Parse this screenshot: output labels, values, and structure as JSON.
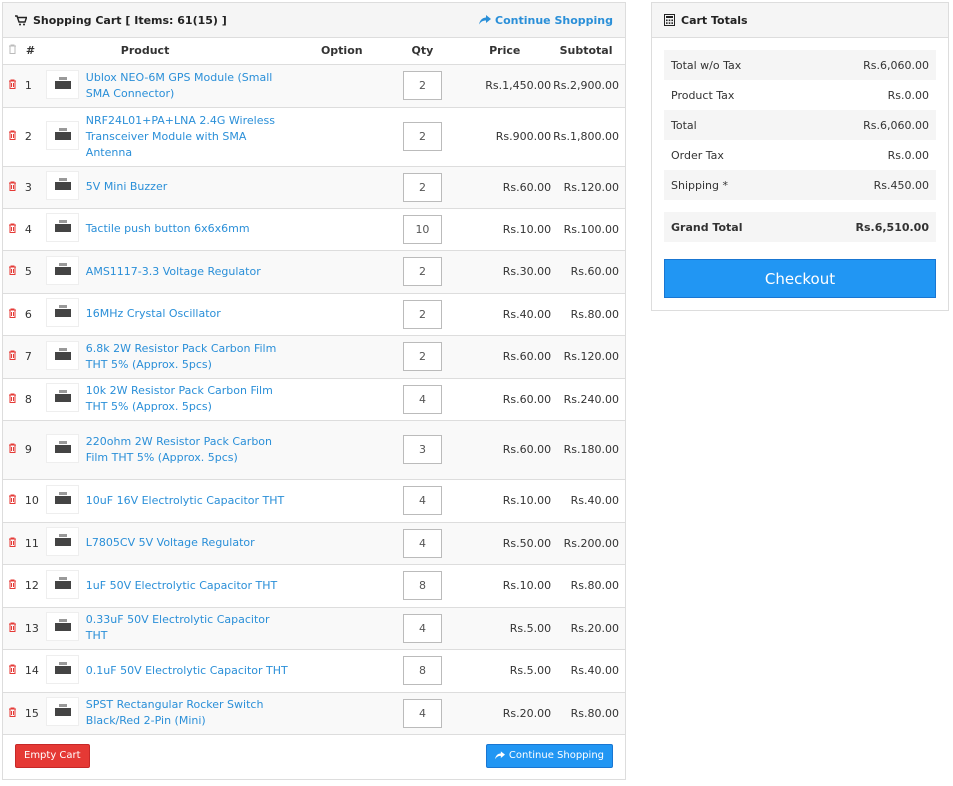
{
  "cart": {
    "title": "Shopping Cart [ Items: 61(15) ]",
    "continue_label": "Continue Shopping",
    "columns": {
      "num": "#",
      "product": "Product",
      "option": "Option",
      "qty": "Qty",
      "price": "Price",
      "subtotal": "Subtotal"
    },
    "items": [
      {
        "num": "1",
        "name": "Ublox NEO-6M GPS Module (Small SMA Connector)",
        "option": "",
        "qty": "2",
        "price": "Rs.1,450.00",
        "subtotal": "Rs.2,900.00"
      },
      {
        "num": "2",
        "name": "NRF24L01+PA+LNA 2.4G Wireless Transceiver Module with SMA Antenna",
        "option": "",
        "qty": "2",
        "price": "Rs.900.00",
        "subtotal": "Rs.1,800.00"
      },
      {
        "num": "3",
        "name": "5V Mini Buzzer",
        "option": "",
        "qty": "2",
        "price": "Rs.60.00",
        "subtotal": "Rs.120.00"
      },
      {
        "num": "4",
        "name": "Tactile push button 6x6x6mm",
        "option": "",
        "qty": "10",
        "price": "Rs.10.00",
        "subtotal": "Rs.100.00"
      },
      {
        "num": "5",
        "name": "AMS1117-3.3 Voltage Regulator",
        "option": "",
        "qty": "2",
        "price": "Rs.30.00",
        "subtotal": "Rs.60.00"
      },
      {
        "num": "6",
        "name": "16MHz Crystal Oscillator",
        "option": "",
        "qty": "2",
        "price": "Rs.40.00",
        "subtotal": "Rs.80.00"
      },
      {
        "num": "7",
        "name": "6.8k 2W Resistor Pack Carbon Film THT 5% (Approx. 5pcs)",
        "option": "",
        "qty": "2",
        "price": "Rs.60.00",
        "subtotal": "Rs.120.00"
      },
      {
        "num": "8",
        "name": "10k 2W Resistor Pack Carbon Film THT 5% (Approx. 5pcs)",
        "option": "",
        "qty": "4",
        "price": "Rs.60.00",
        "subtotal": "Rs.240.00"
      },
      {
        "num": "9",
        "name": "220ohm 2W Resistor Pack Carbon Film THT 5% (Approx. 5pcs)",
        "option": "",
        "qty": "3",
        "price": "Rs.60.00",
        "subtotal": "Rs.180.00"
      },
      {
        "num": "10",
        "name": "10uF 16V Electrolytic Capacitor THT",
        "option": "",
        "qty": "4",
        "price": "Rs.10.00",
        "subtotal": "Rs.40.00"
      },
      {
        "num": "11",
        "name": "L7805CV 5V Voltage Regulator",
        "option": "",
        "qty": "4",
        "price": "Rs.50.00",
        "subtotal": "Rs.200.00"
      },
      {
        "num": "12",
        "name": "1uF 50V Electrolytic Capacitor THT",
        "option": "",
        "qty": "8",
        "price": "Rs.10.00",
        "subtotal": "Rs.80.00"
      },
      {
        "num": "13",
        "name": "0.33uF 50V Electrolytic Capacitor THT",
        "option": "",
        "qty": "4",
        "price": "Rs.5.00",
        "subtotal": "Rs.20.00"
      },
      {
        "num": "14",
        "name": "0.1uF 50V Electrolytic Capacitor THT",
        "option": "",
        "qty": "8",
        "price": "Rs.5.00",
        "subtotal": "Rs.40.00"
      },
      {
        "num": "15",
        "name": "SPST Rectangular Rocker Switch Black/Red 2-Pin (Mini)",
        "option": "",
        "qty": "4",
        "price": "Rs.20.00",
        "subtotal": "Rs.80.00"
      }
    ],
    "empty_cart_label": "Empty Cart",
    "footer_continue_label": "Continue Shopping"
  },
  "totals": {
    "title": "Cart Totals",
    "rows": [
      {
        "label": "Total w/o Tax",
        "value": "Rs.6,060.00"
      },
      {
        "label": "Product Tax",
        "value": "Rs.0.00"
      },
      {
        "label": "Total",
        "value": "Rs.6,060.00"
      },
      {
        "label": "Order Tax",
        "value": "Rs.0.00"
      },
      {
        "label": "Shipping *",
        "value": "Rs.450.00"
      }
    ],
    "grand_label": "Grand Total",
    "grand_value": "Rs.6,510.00",
    "checkout_label": "Checkout"
  },
  "colors": {
    "link": "#2a8fd8",
    "danger": "#e53935",
    "primary": "#2196f3"
  },
  "icons": {
    "cart": "shopping-cart-icon",
    "share": "share-arrow-icon",
    "trash": "trash-icon",
    "calculator": "calculator-icon"
  }
}
